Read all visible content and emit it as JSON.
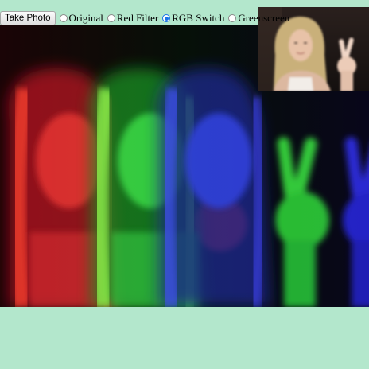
{
  "controls": {
    "take_photo_label": "Take Photo",
    "filters": [
      {
        "label": "Original",
        "selected": false
      },
      {
        "label": "Red Filter",
        "selected": false
      },
      {
        "label": "RGB Switch",
        "selected": true
      },
      {
        "label": "Greenscreen",
        "selected": false
      }
    ]
  },
  "colors": {
    "page_background": "#b3e7cc",
    "radio_accent": "#1a73e8"
  }
}
